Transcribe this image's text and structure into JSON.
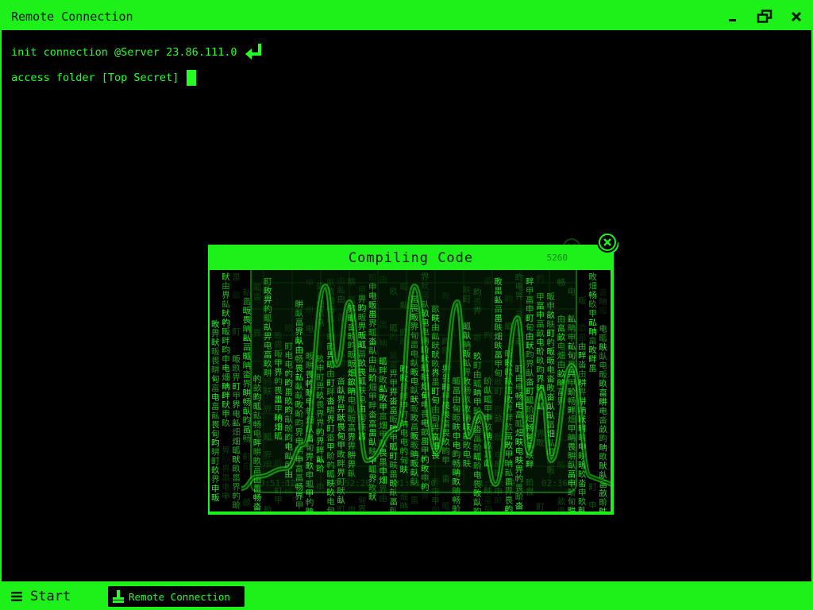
{
  "colors": {
    "accent": "#1ef01a",
    "text": "#23ff23",
    "background": "#000000"
  },
  "window": {
    "title": "Remote Connection",
    "controls": [
      {
        "name": "minimize",
        "icon": "minimize-icon"
      },
      {
        "name": "restore",
        "icon": "restore-icon"
      },
      {
        "name": "close",
        "icon": "close-icon"
      }
    ]
  },
  "terminal": {
    "lines": [
      {
        "text": "init connection @Server 23.86.111.0",
        "icon": "enter-arrow-icon"
      },
      {
        "text": "access folder [Top Secret]",
        "icon": "cursor-block"
      }
    ]
  },
  "dialog": {
    "title": "Compiling Code",
    "counter": "5260",
    "timestamps": [
      "00:51:12",
      "00:52:20",
      "01:53:20",
      "01:53:09",
      "02:36:14"
    ],
    "glyphs": "甲畝界电町甸由申畀畃畂畅畆畇畈畉畊畋畍畎畏畐畑畒畓畔畕畖畗畘",
    "close_icon": "close-icon"
  },
  "taskbar": {
    "start_label": "Start",
    "start_icon": "hamburger-menu-icon",
    "tasks": [
      {
        "label": "Remote Connection",
        "icon": "terminal-app-icon"
      }
    ]
  }
}
